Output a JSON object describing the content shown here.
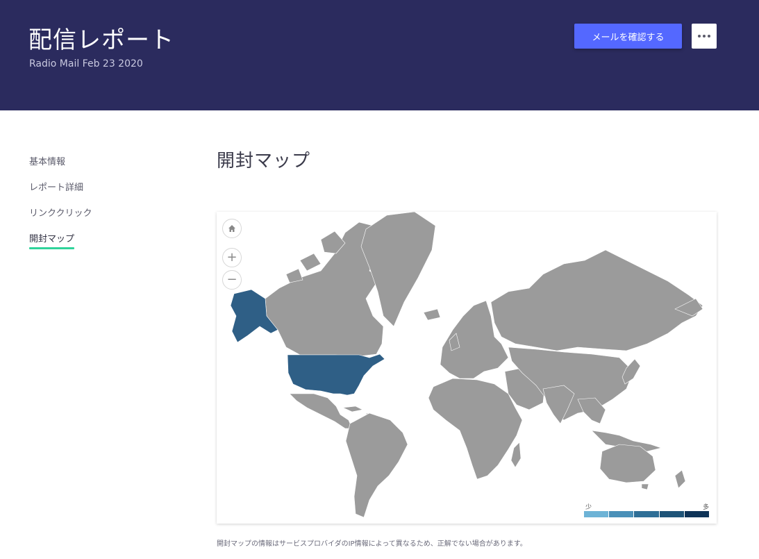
{
  "header": {
    "title": "配信レポート",
    "subtitle": "Radio Mail Feb 23 2020",
    "primary_button": "メールを確認する",
    "more_icon": "more-horizontal-icon",
    "bg_color": "#2b2b5e",
    "accent_color": "#5468ff"
  },
  "sidebar": {
    "items": [
      {
        "label": "基本情報",
        "active": false
      },
      {
        "label": "レポート詳細",
        "active": false
      },
      {
        "label": "リンククリック",
        "active": false
      },
      {
        "label": "開封マップ",
        "active": true
      }
    ],
    "active_indicator_color": "#2fd39a"
  },
  "main": {
    "section_title": "開封マップ",
    "map": {
      "controls": [
        "home-icon",
        "zoom-in-icon",
        "zoom-out-icon"
      ],
      "highlighted_countries": [
        "United States"
      ],
      "highlight_color": "#2f5f86",
      "default_color": "#9b9b9b",
      "legend": {
        "low_label": "少",
        "high_label": "多",
        "colors": [
          "#6db3d6",
          "#4a90b8",
          "#2f6f97",
          "#1f5478",
          "#0f3458"
        ]
      }
    },
    "footnote": "開封マップの情報はサービスプロバイダのIP情報によって異なるため、正解でない場合があります。"
  }
}
